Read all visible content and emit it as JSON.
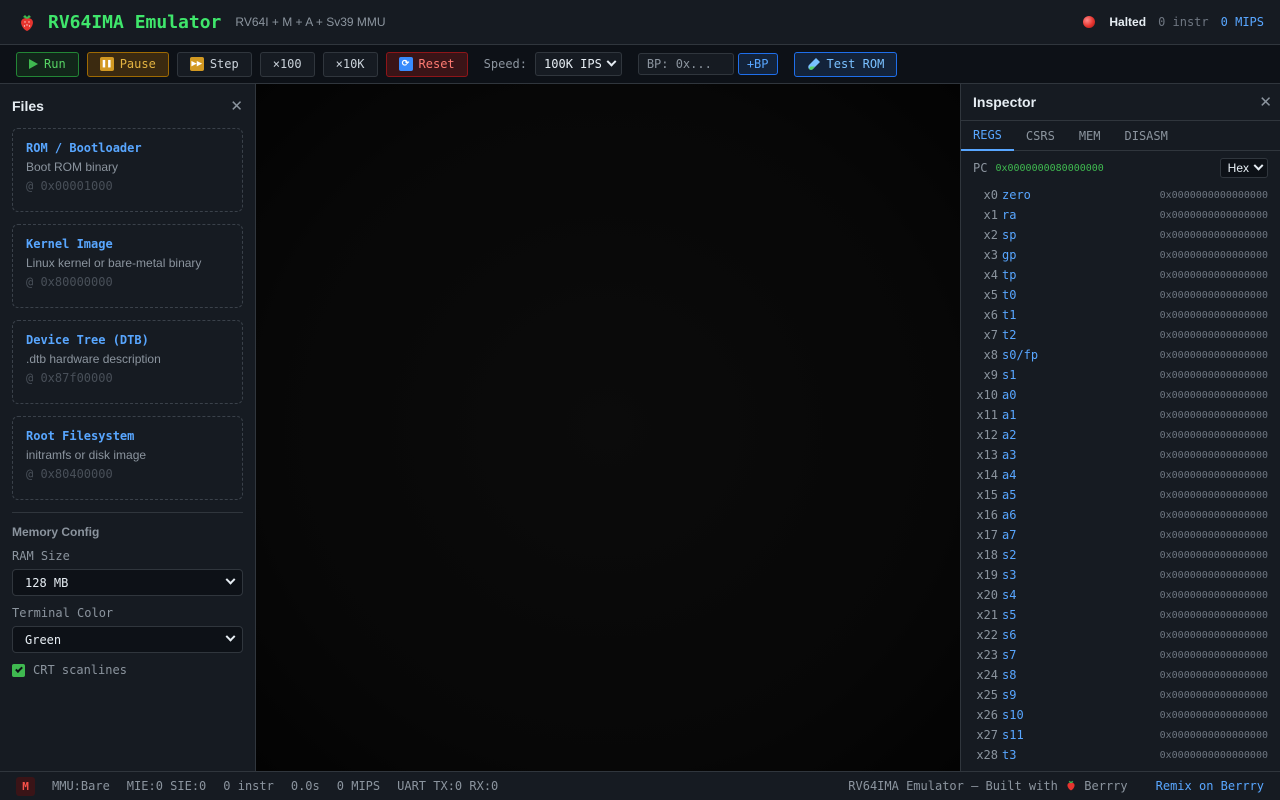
{
  "header": {
    "title": "RV64IMA Emulator",
    "subtitle": "RV64I + M + A + Sv39 MMU",
    "status": "Halted",
    "instr": "0 instr",
    "mips": "0 MIPS"
  },
  "toolbar": {
    "run": "Run",
    "pause": "Pause",
    "step": "Step",
    "x100": "×100",
    "x10k": "×10K",
    "reset": "Reset",
    "speed_label": "Speed:",
    "speed_value": "100K IPS",
    "bp_placeholder": "BP: 0x...",
    "add_bp": "+BP",
    "test_rom": "Test ROM"
  },
  "files": {
    "title": "Files",
    "cards": [
      {
        "title": "ROM / Bootloader",
        "desc": "Boot ROM binary",
        "addr": "@ 0x00001000"
      },
      {
        "title": "Kernel Image",
        "desc": "Linux kernel or bare-metal binary",
        "addr": "@ 0x80000000"
      },
      {
        "title": "Device Tree (DTB)",
        "desc": ".dtb hardware description",
        "addr": "@ 0x87f00000"
      },
      {
        "title": "Root Filesystem",
        "desc": "initramfs or disk image",
        "addr": "@ 0x80400000"
      }
    ],
    "memory_config": "Memory Config",
    "ram_label": "RAM Size",
    "ram_value": "128 MB",
    "color_label": "Terminal Color",
    "color_value": "Green",
    "crt_label": "CRT scanlines",
    "crt_checked": true
  },
  "inspector": {
    "title": "Inspector",
    "tabs": [
      "REGS",
      "CSRS",
      "MEM",
      "DISASM"
    ],
    "active_tab": "REGS",
    "pc_label": "PC",
    "pc_value": "0x0000000080000000",
    "format": "Hex",
    "registers": [
      {
        "idx": "x0",
        "name": "zero",
        "value": "0x0000000000000000"
      },
      {
        "idx": "x1",
        "name": "ra",
        "value": "0x0000000000000000"
      },
      {
        "idx": "x2",
        "name": "sp",
        "value": "0x0000000000000000"
      },
      {
        "idx": "x3",
        "name": "gp",
        "value": "0x0000000000000000"
      },
      {
        "idx": "x4",
        "name": "tp",
        "value": "0x0000000000000000"
      },
      {
        "idx": "x5",
        "name": "t0",
        "value": "0x0000000000000000"
      },
      {
        "idx": "x6",
        "name": "t1",
        "value": "0x0000000000000000"
      },
      {
        "idx": "x7",
        "name": "t2",
        "value": "0x0000000000000000"
      },
      {
        "idx": "x8",
        "name": "s0/fp",
        "value": "0x0000000000000000"
      },
      {
        "idx": "x9",
        "name": "s1",
        "value": "0x0000000000000000"
      },
      {
        "idx": "x10",
        "name": "a0",
        "value": "0x0000000000000000"
      },
      {
        "idx": "x11",
        "name": "a1",
        "value": "0x0000000000000000"
      },
      {
        "idx": "x12",
        "name": "a2",
        "value": "0x0000000000000000"
      },
      {
        "idx": "x13",
        "name": "a3",
        "value": "0x0000000000000000"
      },
      {
        "idx": "x14",
        "name": "a4",
        "value": "0x0000000000000000"
      },
      {
        "idx": "x15",
        "name": "a5",
        "value": "0x0000000000000000"
      },
      {
        "idx": "x16",
        "name": "a6",
        "value": "0x0000000000000000"
      },
      {
        "idx": "x17",
        "name": "a7",
        "value": "0x0000000000000000"
      },
      {
        "idx": "x18",
        "name": "s2",
        "value": "0x0000000000000000"
      },
      {
        "idx": "x19",
        "name": "s3",
        "value": "0x0000000000000000"
      },
      {
        "idx": "x20",
        "name": "s4",
        "value": "0x0000000000000000"
      },
      {
        "idx": "x21",
        "name": "s5",
        "value": "0x0000000000000000"
      },
      {
        "idx": "x22",
        "name": "s6",
        "value": "0x0000000000000000"
      },
      {
        "idx": "x23",
        "name": "s7",
        "value": "0x0000000000000000"
      },
      {
        "idx": "x24",
        "name": "s8",
        "value": "0x0000000000000000"
      },
      {
        "idx": "x25",
        "name": "s9",
        "value": "0x0000000000000000"
      },
      {
        "idx": "x26",
        "name": "s10",
        "value": "0x0000000000000000"
      },
      {
        "idx": "x27",
        "name": "s11",
        "value": "0x0000000000000000"
      },
      {
        "idx": "x28",
        "name": "t3",
        "value": "0x0000000000000000"
      }
    ]
  },
  "statusbar": {
    "mode": "M",
    "mmu": "MMU:Bare",
    "interrupts": "MIE:0 SIE:0",
    "instr": "0 instr",
    "time": "0.0s",
    "mips": "0 MIPS",
    "uart": "UART TX:0 RX:0",
    "built_with": "RV64IMA Emulator — Built with",
    "brand": "Berrry",
    "remix": "Remix on Berrry"
  },
  "icons": {
    "logo": "strawberry-icon",
    "status": "red-circle-icon",
    "run": "play-icon",
    "pause": "pause-icon",
    "step": "fast-forward-icon",
    "reset": "refresh-icon",
    "test": "test-tube-icon"
  },
  "colors": {
    "accent_green": "#3fe66b",
    "link_blue": "#58a6ff",
    "danger_red": "#f85149"
  }
}
